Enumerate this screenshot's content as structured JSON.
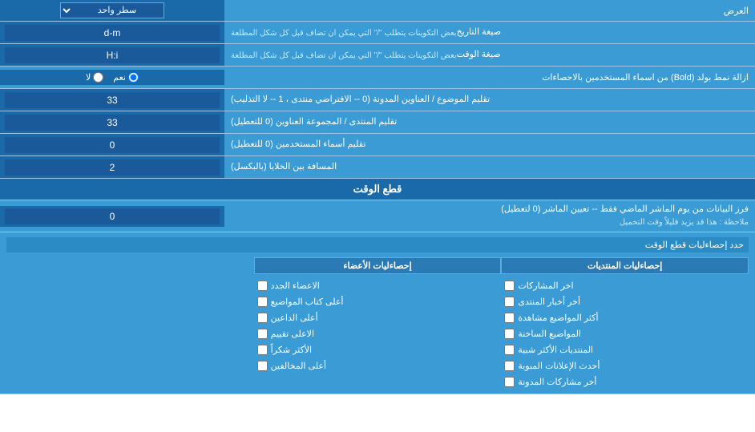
{
  "page": {
    "title": "العرض",
    "rows": [
      {
        "id": "display-mode",
        "label": "العرض",
        "input_type": "select",
        "options": [
          "سطر واحد"
        ],
        "value": "سطر واحد"
      },
      {
        "id": "date-format",
        "label": "صيغة التاريخ",
        "sub_label": "بعض التكوينات يتطلب \"/\" التي يمكن ان تضاف قبل كل شكل المطلعة",
        "input_type": "text",
        "value": "d-m"
      },
      {
        "id": "time-format",
        "label": "صيغة الوقت",
        "sub_label": "بعض التكوينات يتطلب \"/\" التي يمكن ان تضاف قبل كل شكل المطلعة",
        "input_type": "text",
        "value": "H:i"
      },
      {
        "id": "bold-remove",
        "label": "ازالة نمط بولد (Bold) من اسماء المستخدمين بالاحصاءات",
        "input_type": "radio",
        "options": [
          "نعم",
          "لا"
        ],
        "value": "نعم"
      },
      {
        "id": "topic-titles",
        "label": "تقليم الموضوع / العناوين المدونة (0 -- الافتراضي منتدى ، 1 -- لا التذليب)",
        "input_type": "text",
        "value": "33"
      },
      {
        "id": "forum-titles",
        "label": "تقليم المنتدى / المجموعة العناوين (0 للتعطيل)",
        "input_type": "text",
        "value": "33"
      },
      {
        "id": "username-trim",
        "label": "تقليم أسماء المستخدمين (0 للتعطيل)",
        "input_type": "text",
        "value": "0"
      },
      {
        "id": "cell-padding",
        "label": "المسافة بين الخلايا (بالبكسل)",
        "input_type": "text",
        "value": "2"
      }
    ],
    "cutoff_section": {
      "title": "قطع الوقت",
      "rows": [
        {
          "id": "cutoff-days",
          "label": "فرز البيانات من يوم الماشر الماضي فقط -- تعيين الماشر (0 لتعطيل)",
          "note": "ملاحظة : هذا قد يزيد قليلاً وقت التحميل",
          "input_type": "text",
          "value": "0"
        }
      ]
    },
    "stats_section": {
      "limit_label": "حدد إحصاءليات قطع الوقت",
      "columns": [
        {
          "header": "إحصاءليات المنتديات",
          "items": [
            "اخر المشاركات",
            "أخر أخبار المنتدى",
            "أكثر المواضيع مشاهدة",
            "المواضيع الساخنة",
            "المنتديات الأكثر شبية",
            "أحدث الإعلانات المبوبة",
            "أخر مشاركات المدونة"
          ]
        },
        {
          "header": "إحصاءليات الأعضاء",
          "items": [
            "الاعضاء الجدد",
            "أعلى كتاب المواضيع",
            "أعلى الداعين",
            "الاعلى تقييم",
            "الأكثر شكراً",
            "أعلى المخالفين"
          ]
        }
      ]
    }
  }
}
